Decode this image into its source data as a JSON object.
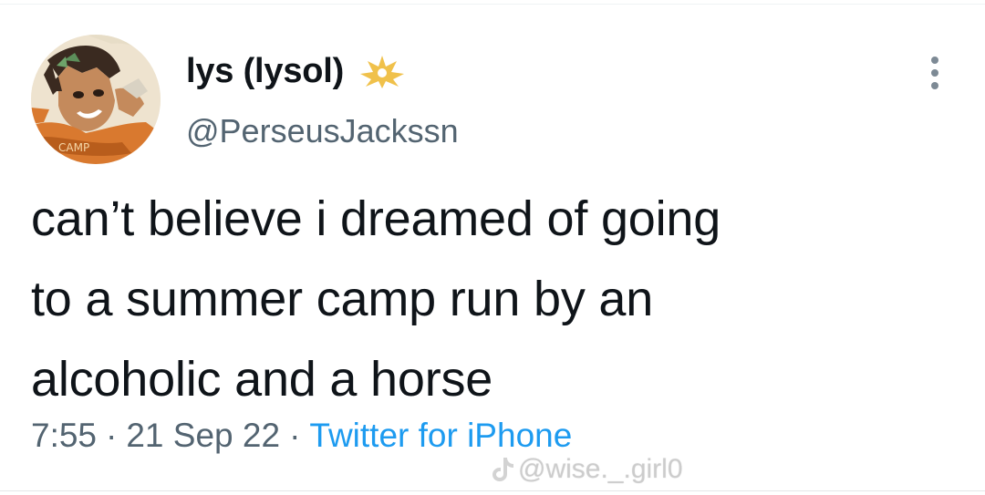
{
  "author": {
    "display_name": "lys (lysol)",
    "handle": "@PerseusJackssn",
    "badge_icon": "golden-emblem-icon",
    "avatar_icon": "anime-character-avatar"
  },
  "tweet": {
    "text_lines": [
      "can’t believe i dreamed of going",
      "to a summer camp run by an",
      "alcoholic and a horse"
    ],
    "time": "7:55",
    "date": "21 Sep 22",
    "separator": "·",
    "source": "Twitter for iPhone"
  },
  "watermark": {
    "text": "@wise._.girl0",
    "icon": "tiktok-icon"
  },
  "colors": {
    "text": "#0f1419",
    "secondary": "#536471",
    "link": "#1d9bf0",
    "badge": "#f0c14b"
  }
}
